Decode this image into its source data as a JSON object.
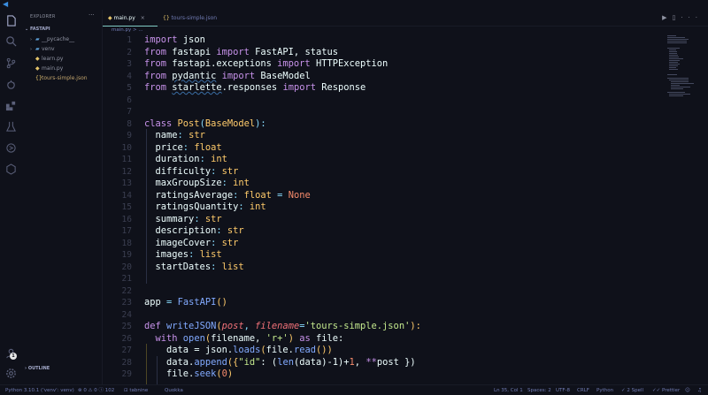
{
  "sidebar": {
    "title": "EXPLORER",
    "more": "···",
    "folder": "FASTAPI",
    "items": [
      {
        "label": "__pycache__",
        "type": "folder"
      },
      {
        "label": "venv",
        "type": "folder"
      },
      {
        "label": "learn.py",
        "type": "py"
      },
      {
        "label": "main.py",
        "type": "py"
      },
      {
        "label": "tours-simple.json",
        "type": "json"
      }
    ],
    "outline": "OUTLINE"
  },
  "tabs": [
    {
      "label": "main.py",
      "close": "×"
    },
    {
      "label": "tours-simple.json",
      "close": ""
    }
  ],
  "breadcrumb": "main.py > ...",
  "line_numbers": [
    "1",
    "2",
    "3",
    "4",
    "5",
    "6",
    "7",
    "8",
    "9",
    "10",
    "11",
    "12",
    "13",
    "14",
    "15",
    "16",
    "17",
    "18",
    "19",
    "20",
    "21",
    "22",
    "23",
    "24",
    "25",
    "26",
    "27",
    "28",
    "29"
  ],
  "code": {
    "l1": {
      "k1": "import",
      "t1": " json"
    },
    "l2": {
      "k1": "from",
      "t1": " fastapi ",
      "k2": "import",
      "t2": " FastAPI, status"
    },
    "l3": {
      "k1": "from",
      "t1": " fastapi.exceptions ",
      "k2": "import",
      "t2": " HTTPException"
    },
    "l4": {
      "k1": "from",
      "t1": " ",
      "mod": "pydantic",
      "t2": " ",
      "k2": "import",
      "t3": " BaseModel"
    },
    "l5": {
      "k1": "from",
      "t1": " ",
      "mod": "starlette",
      "t2": ".responses ",
      "k2": "import",
      "t3": " Response"
    },
    "l8": {
      "k1": "class",
      "cls": " Post",
      "p1": "(",
      "base": "BaseModel",
      "p2": "):"
    },
    "fields": [
      {
        "name": "name",
        "type": "str"
      },
      {
        "name": "price",
        "type": "float"
      },
      {
        "name": "duration",
        "type": "int"
      },
      {
        "name": "difficulty",
        "type": "str"
      },
      {
        "name": "maxGroupSize",
        "type": "int"
      },
      {
        "name": "ratingsAverage",
        "type": "float",
        "eq": " = ",
        "def": "None"
      },
      {
        "name": "ratingsQuantity",
        "type": "int"
      },
      {
        "name": "summary",
        "type": "str"
      },
      {
        "name": "description",
        "type": "str"
      },
      {
        "name": "imageCover",
        "type": "str"
      },
      {
        "name": "images",
        "type": "list"
      },
      {
        "name": "startDates",
        "type": "list"
      }
    ],
    "l23": {
      "v": "app",
      "eq": " = ",
      "f": "FastAPI",
      "p": "()"
    },
    "l25": {
      "k": "def",
      "f": " writeJSON",
      "p1": "(",
      "a1": "post",
      "c1": ", ",
      "a2": "filename",
      "eq": "=",
      "s": "'tours-simple.json'",
      "p2": "):"
    },
    "l26": {
      "k": "with",
      "f": " open",
      "p1": "(",
      "t1": "filename, ",
      "s": "'r+'",
      "p2": ") ",
      "k2": "as",
      "t2": " file:"
    },
    "l27": {
      "t1": "data = json.",
      "f": "loads",
      "p1": "(",
      "t2": "file.",
      "f2": "read",
      "p2": "())"
    },
    "l28": {
      "t1": "data.",
      "f": "append",
      "p1": "({",
      "s": "\"id\"",
      "t2": ": (",
      "f2": "len",
      "t3": "(data)-1)+",
      "n": "1",
      "t4": ", ",
      "op": "**",
      "t5": "post })"
    },
    "l29": {
      "t1": "file.",
      "f": "seek",
      "p1": "(",
      "n": "0",
      "p2": ")"
    }
  },
  "status": {
    "python": "Python 3.10.1 ('venv': venv)",
    "errors": "0",
    "warnings": "0",
    "info": "102",
    "tabnine": "tabnine",
    "quokka": "Quokka",
    "position": "Ln 35, Col 1",
    "spaces": "Spaces: 2",
    "encoding": "UTF-8",
    "eol": "CRLF",
    "language": "Python",
    "spell": "2 Spell",
    "prettier": "Prettier"
  },
  "accounts_badge": "1"
}
